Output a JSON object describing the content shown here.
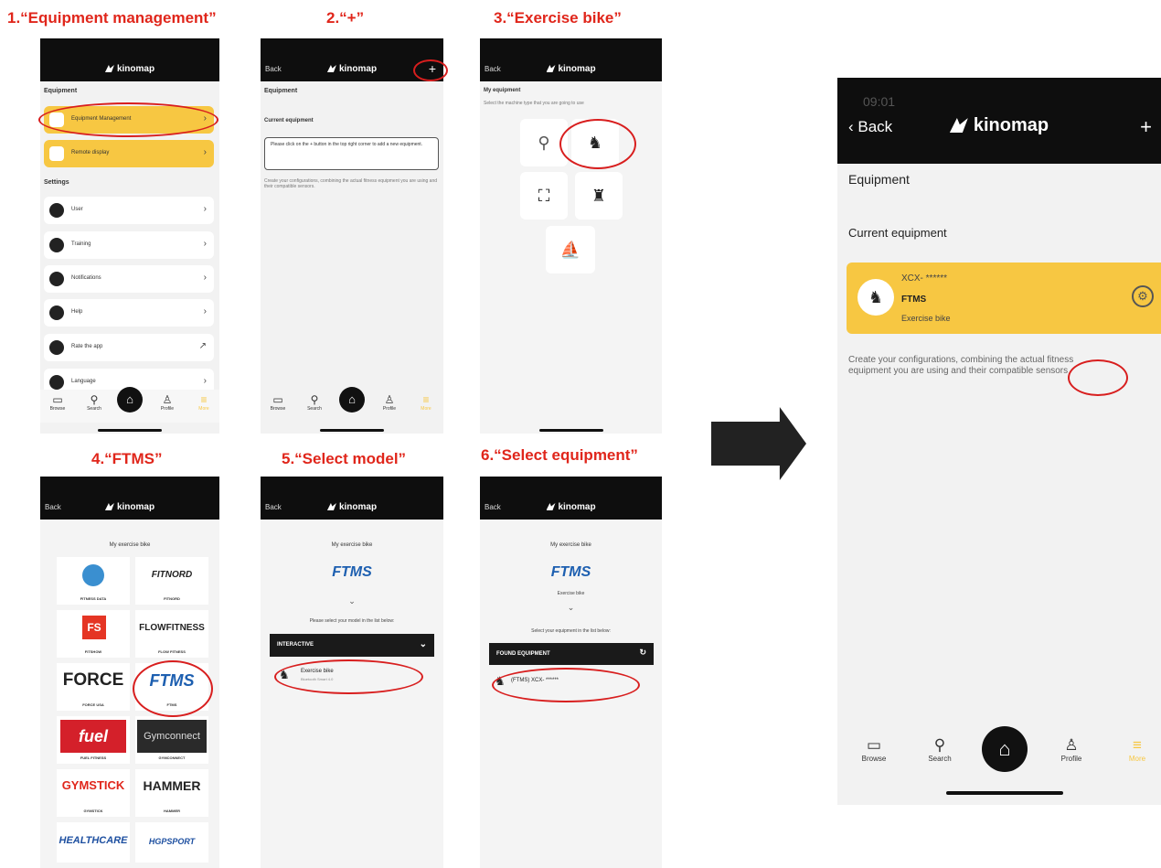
{
  "steps": [
    {
      "title": "1.“Equipment  management”"
    },
    {
      "title": "2.“+”"
    },
    {
      "title": "3.“Exercise bike”"
    },
    {
      "title": "4.“FTMS”"
    },
    {
      "title": "5.“Select model”"
    },
    {
      "title": "6.“Select equipment”"
    }
  ],
  "app": {
    "logo": "kinomap",
    "back": "Back",
    "plus": "+"
  },
  "screen1": {
    "section_equipment": "Equipment",
    "item_equipment_management": "Equipment Management",
    "item_remote_display": "Remote display",
    "section_settings": "Settings",
    "items": [
      "User",
      "Training",
      "Notifications",
      "Help",
      "Rate the app",
      "Language"
    ]
  },
  "tabs": {
    "browse": "Browse",
    "search": "Search",
    "profile": "Profile",
    "more": "More"
  },
  "screen2": {
    "section_equipment": "Equipment",
    "current_equipment": "Current equipment",
    "hint": "Please click on the + button in the top right corner to add a new equipment.",
    "footer": "Create your configurations, combining the actual fitness equipment you are using and their compatible sensors."
  },
  "screen3": {
    "title": "My equipment",
    "subtitle": "Select the machine type that you are going to use"
  },
  "screen4": {
    "title": "My exercise bike",
    "brands": [
      {
        "name": "",
        "label": "FITNESS DATA"
      },
      {
        "name": "FITNORD",
        "label": "FITNORD"
      },
      {
        "name": "FS",
        "label": "FITSHOW"
      },
      {
        "name": "FLOWFITNESS",
        "label": "FLOW FITNESS"
      },
      {
        "name": "FORCE",
        "label": "FORCE USA"
      },
      {
        "name": "FTMS",
        "label": "FTMS"
      },
      {
        "name": "fuel",
        "label": "FUEL FITNESS"
      },
      {
        "name": "Gymconnect",
        "label": "GYMCONNECT"
      },
      {
        "name": "GYMSTICK",
        "label": "GYMSTICK"
      },
      {
        "name": "HAMMER",
        "label": "HAMMER"
      },
      {
        "name": "HEALTHCARE",
        "label": ""
      },
      {
        "name": "HGPSPORT",
        "label": ""
      }
    ]
  },
  "screen5": {
    "title": "My exercise bike",
    "brand": "FTMS",
    "prompt": "Please select your model in the list below:",
    "dropdown": "INTERACTIVE",
    "model_name": "Exercise bike",
    "model_sub": "Bluetooth Smart 4.0"
  },
  "screen6": {
    "title": "My exercise bike",
    "brand": "FTMS",
    "brand_sub": "Exercise bike",
    "prompt": "Select your equipment in the list below:",
    "found": "FOUND EQUIPMENT",
    "device": "(FTMS) XCX- ******"
  },
  "big": {
    "time": "09:01",
    "back": "Back",
    "logo": "kinomap",
    "plus": "+",
    "section_equipment": "Equipment",
    "current_equipment": "Current equipment",
    "card_name": "XCX- ******",
    "card_protocol": "FTMS",
    "card_type": "Exercise bike",
    "footer_line1": "Create your configurations, combining the actual fitness",
    "footer_line2": "equipment you are using and their compatible sensors",
    "tabs": {
      "browse": "Browse",
      "search": "Search",
      "profile": "Profile",
      "more": "More"
    }
  },
  "colors": {
    "accent": "#f7c742",
    "annotation": "#d81e1e",
    "topbar": "#0e0e0e"
  }
}
